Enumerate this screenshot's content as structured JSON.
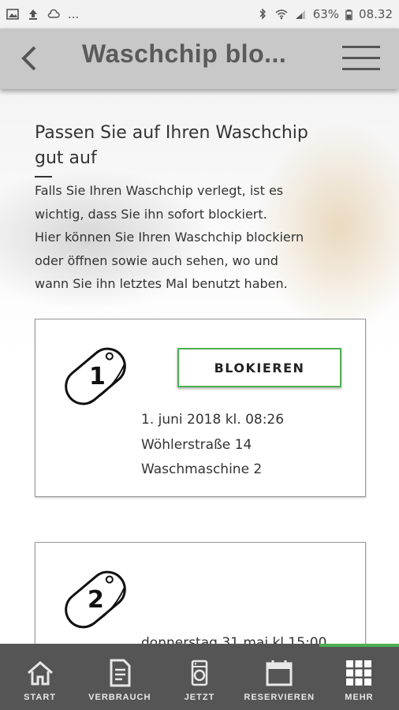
{
  "status_bar": {
    "left_icons": [
      "image-icon",
      "upload-icon",
      "cloud-icon"
    ],
    "more": "...",
    "battery": "63%",
    "time": "08.32"
  },
  "appbar": {
    "title": "Waschchip blo..."
  },
  "intro": {
    "title_line1": "Passen Sie auf Ihren Waschchip",
    "title_line2": "gut auf",
    "text_lines": [
      "Falls Sie Ihren Waschchip verlegt, ist es",
      "wichtig, dass Sie ihn sofort blockiert.",
      "Hier können Sie Ihren Waschchip blockiern",
      "oder öffnen sowie auch sehen, wo und",
      "wann Sie ihn letztes Mal benutzt haben."
    ]
  },
  "chips": [
    {
      "number": "1",
      "button_label": "BLOKIEREN",
      "date": "1. juni 2018 kl. 08:26",
      "address": "Wöhlerstraße 14",
      "machine": "Waschmaschine 2"
    },
    {
      "number": "2",
      "partial_text": "donnerstag 31 mai kl 15:00"
    }
  ],
  "bottom_nav": {
    "items": [
      {
        "label": "START",
        "icon": "home-icon"
      },
      {
        "label": "VERBRAUCH",
        "icon": "document-icon"
      },
      {
        "label": "JETZT",
        "icon": "washing-machine-icon"
      },
      {
        "label": "RESERVIEREN",
        "icon": "calendar-icon"
      },
      {
        "label": "MEHR",
        "icon": "grid-icon"
      }
    ],
    "active_index": 4,
    "active_color": "#4caf50"
  }
}
